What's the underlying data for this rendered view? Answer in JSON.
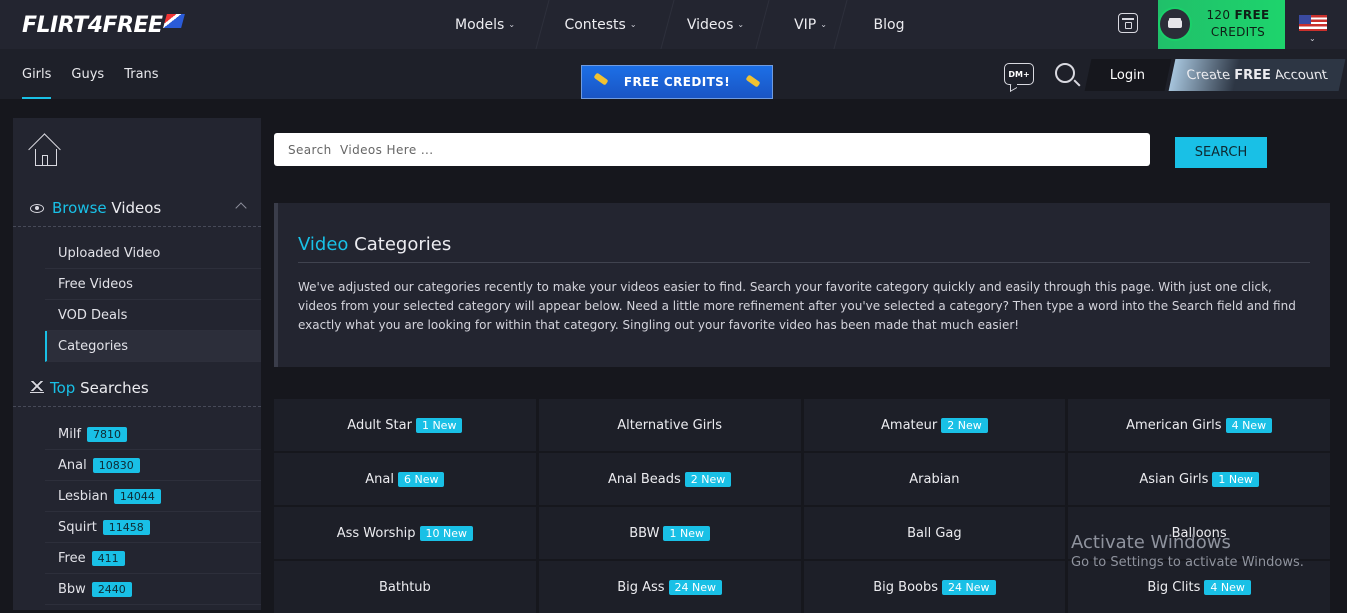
{
  "header": {
    "logo": "Flirt4Free",
    "nav": [
      {
        "label": "Models",
        "has_dropdown": true
      },
      {
        "label": "Contests",
        "has_dropdown": true
      },
      {
        "label": "Videos",
        "has_dropdown": true
      },
      {
        "label": "VIP",
        "has_dropdown": true
      },
      {
        "label": "Blog",
        "has_dropdown": false
      }
    ],
    "credits_amount": "120",
    "credits_free": "FREE",
    "credits_label": "CREDITS",
    "icons": [
      "calendar-icon",
      "credits-coin-icon",
      "us-flag-icon"
    ]
  },
  "subheader": {
    "tabs": [
      {
        "label": "Girls",
        "active": true
      },
      {
        "label": "Guys",
        "active": false
      },
      {
        "label": "Trans",
        "active": false
      }
    ],
    "banner": "FREE CREDITS!",
    "dm_label": "DM+",
    "login": "Login",
    "create_prefix": "Create",
    "create_bold": "FREE",
    "create_suffix": "Account"
  },
  "sidebar": {
    "browse_accent": "Browse",
    "browse_rest": "Videos",
    "browse_items": [
      {
        "label": "Uploaded Video",
        "active": false
      },
      {
        "label": "Free Videos",
        "active": false
      },
      {
        "label": "VOD Deals",
        "active": false
      },
      {
        "label": "Categories",
        "active": true
      }
    ],
    "top_accent": "Top",
    "top_rest": "Searches",
    "top_items": [
      {
        "label": "Milf",
        "count": "7810"
      },
      {
        "label": "Anal",
        "count": "10830"
      },
      {
        "label": "Lesbian",
        "count": "14044"
      },
      {
        "label": "Squirt",
        "count": "11458"
      },
      {
        "label": "Free",
        "count": "411"
      },
      {
        "label": "Bbw",
        "count": "2440"
      }
    ]
  },
  "search": {
    "placeholder": "Search  Videos Here ...",
    "button": "SEARCH"
  },
  "info": {
    "title_accent": "Video",
    "title_rest": "Categories",
    "body": "We've adjusted our categories recently to make your videos easier to find. Search your favorite category quickly and easily through this page. With just one click, videos from your selected category will appear below. Need a little more refinement after you've selected a category? Then type a word into the Search field and find exactly what you are looking for within that category. Singling out your favorite video has been made that much easier!"
  },
  "categories": [
    {
      "name": "Adult Star",
      "badge": "1 New"
    },
    {
      "name": "Alternative Girls",
      "badge": ""
    },
    {
      "name": "Amateur",
      "badge": "2 New"
    },
    {
      "name": "American Girls",
      "badge": "4 New"
    },
    {
      "name": "Anal",
      "badge": "6 New"
    },
    {
      "name": "Anal Beads",
      "badge": "2 New"
    },
    {
      "name": "Arabian",
      "badge": ""
    },
    {
      "name": "Asian Girls",
      "badge": "1 New"
    },
    {
      "name": "Ass Worship",
      "badge": "10 New"
    },
    {
      "name": "BBW",
      "badge": "1 New"
    },
    {
      "name": "Ball Gag",
      "badge": ""
    },
    {
      "name": "Balloons",
      "badge": ""
    },
    {
      "name": "Bathtub",
      "badge": ""
    },
    {
      "name": "Big Ass",
      "badge": "24 New"
    },
    {
      "name": "Big Boobs",
      "badge": "24 New"
    },
    {
      "name": "Big Clits",
      "badge": "4 New"
    }
  ],
  "watermark": {
    "title": "Activate Windows",
    "sub": "Go to Settings to activate Windows."
  },
  "colors": {
    "accent": "#19c0e6",
    "credits_green": "#1ed46c",
    "banner_blue": "#1c6fe6"
  }
}
